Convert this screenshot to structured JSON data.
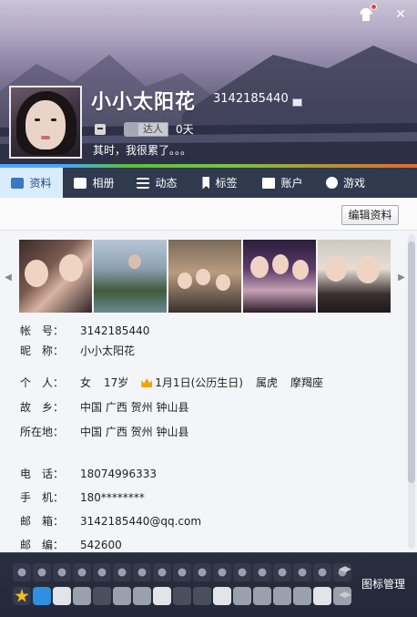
{
  "header": {
    "nickname": "小小太阳花",
    "qq_number": "3142185440",
    "badge_label": "达人",
    "badge_days": "0天",
    "signature": "其时，我很累了。。。"
  },
  "tabs": [
    {
      "label": "资料",
      "icon": "profile-card-icon",
      "active": true
    },
    {
      "label": "相册",
      "icon": "album-icon",
      "active": false
    },
    {
      "label": "动态",
      "icon": "feed-list-icon",
      "active": false
    },
    {
      "label": "标签",
      "icon": "bookmark-icon",
      "active": false
    },
    {
      "label": "账户",
      "icon": "wallet-icon",
      "active": false
    },
    {
      "label": "游戏",
      "icon": "game-icon",
      "active": false
    }
  ],
  "toolbar": {
    "edit_label": "编辑资料"
  },
  "info": {
    "account_label": "帐　号：",
    "account_value": "3142185440",
    "nick_label": "昵　称：",
    "nick_value": "小小太阳花",
    "person_label": "个　人：",
    "gender": "女",
    "age": "17岁",
    "birthday": "1月1日(公历生日)",
    "zodiac": "属虎",
    "constellation": "摩羯座",
    "hometown_label": "故　乡：",
    "hometown_value": "中国 广西 贺州 钟山县",
    "location_label": "所在地：",
    "location_value": "中国 广西 贺州 钟山县",
    "phone_label": "电　话：",
    "phone_value": "18074996333",
    "mobile_label": "手　机：",
    "mobile_value": "180********",
    "email_label": "邮　箱：",
    "email_value": "3142185440@qq.com",
    "zip_label": "邮　编：",
    "zip_value": "542600"
  },
  "tray": {
    "manage_label": "图标管理"
  },
  "colors": {
    "tab_active_bg": "#d9ecfb",
    "tab_bar_bg": "#2f3a4f",
    "accent_orange": "#f2a400"
  }
}
